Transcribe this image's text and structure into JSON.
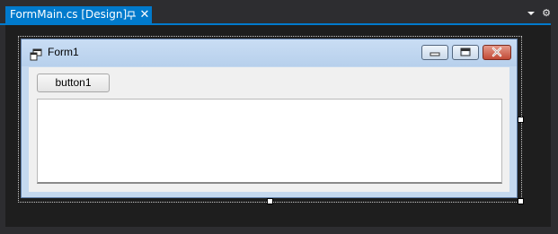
{
  "tab": {
    "title": "FormMain.cs [Design]",
    "accent": "#007acc",
    "pin_icon": "pin-icon",
    "close_icon": "close-icon"
  },
  "toolbar": {
    "dropdown_icon": "chevron-down-icon",
    "settings_icon": "gear-icon"
  },
  "form": {
    "title": "Form1",
    "icon": "form-app-icon",
    "minimize_icon": "minimize-icon",
    "maximize_icon": "maximize-icon",
    "close_icon": "close-icon",
    "button1_label": "button1"
  }
}
